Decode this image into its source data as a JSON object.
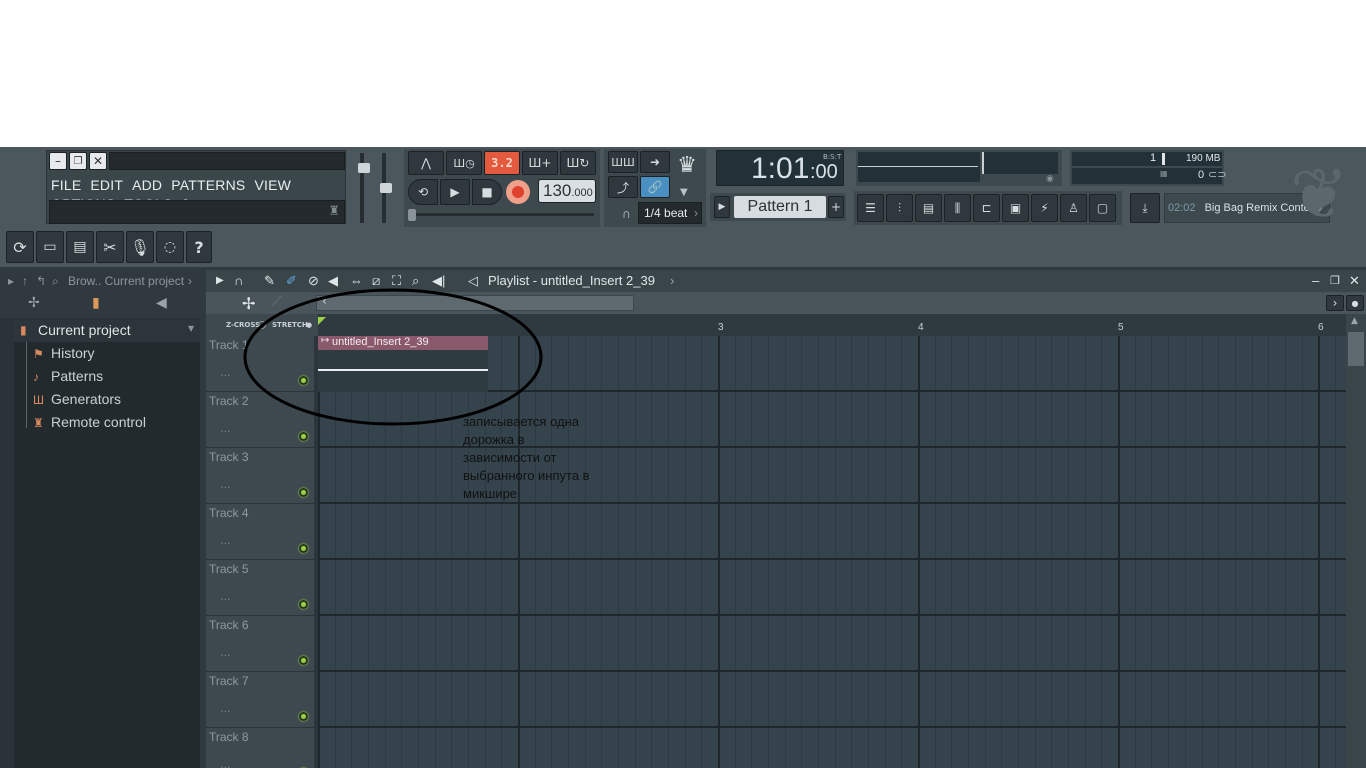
{
  "menu": [
    "FILE",
    "EDIT",
    "ADD",
    "PATTERNS",
    "VIEW",
    "OPTIONS",
    "TOOLS",
    "?"
  ],
  "transport": {
    "pattern_song_badge": "3.2",
    "tempo": "130",
    "tempo_decimals": ".000",
    "snap": "1/4 beat",
    "time_main": "1:01",
    "time_sub": ":00",
    "time_unit": "B:S:T",
    "pattern": "Pattern 1",
    "add_pattern": "+"
  },
  "monitor": {
    "memory": "190 MB",
    "cpu_value": "1",
    "poly_value": "0"
  },
  "hint": {
    "time": "02:02",
    "text": "Big Bag Remix Contest!",
    "arrow": "›"
  },
  "browser": {
    "header": "Brow.. Current project",
    "root": "Current project",
    "items": [
      {
        "label": "History",
        "icon": "history-icon"
      },
      {
        "label": "Patterns",
        "icon": "note-icon"
      },
      {
        "label": "Generators",
        "icon": "piano-icon"
      },
      {
        "label": "Remote control",
        "icon": "remote-icon"
      }
    ]
  },
  "playlist": {
    "title": "Playlist - untitled_Insert 2_39",
    "clip_label": "untitled_Insert 2_39",
    "zcross": "Z-CROSS",
    "stretch": "STRETCH",
    "ruler": [
      "3",
      "4",
      "5",
      "6"
    ],
    "tracks": [
      "Track 1",
      "Track 2",
      "Track 3",
      "Track 4",
      "Track 5",
      "Track 6",
      "Track 7",
      "Track 8"
    ],
    "track_dots": "...",
    "window_controls": {
      "minimize": "–",
      "restore": "❐",
      "close": "✕"
    }
  },
  "annotation": {
    "lines": [
      "записывается одна",
      "дорожка в",
      "зависимости от",
      "выбранного инпута в",
      "микшире"
    ]
  }
}
